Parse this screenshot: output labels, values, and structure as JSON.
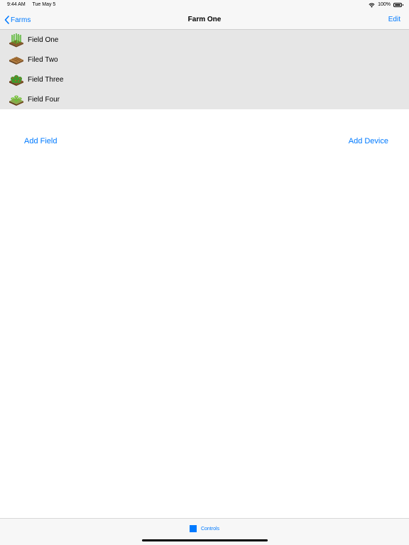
{
  "status_bar": {
    "time": "9:44 AM",
    "date": "Tue May 5",
    "battery": "100%",
    "battery_level": 1.0
  },
  "nav_bar": {
    "back_label": "Farms",
    "title": "Farm One",
    "edit_label": "Edit"
  },
  "fields": [
    {
      "label": "Field One",
      "icon": "crop-field-icon"
    },
    {
      "label": "Filed Two",
      "icon": "soil-field-icon"
    },
    {
      "label": "Field Three",
      "icon": "berry-field-icon"
    },
    {
      "label": "Field Four",
      "icon": "sprout-field-icon"
    }
  ],
  "actions": {
    "add_field": "Add Field",
    "add_device": "Add Device"
  },
  "tab_bar": {
    "controls_label": "Controls"
  },
  "colors": {
    "accent": "#007aff",
    "list_background": "#e6e6e6",
    "bar_background": "#f7f7f7"
  }
}
